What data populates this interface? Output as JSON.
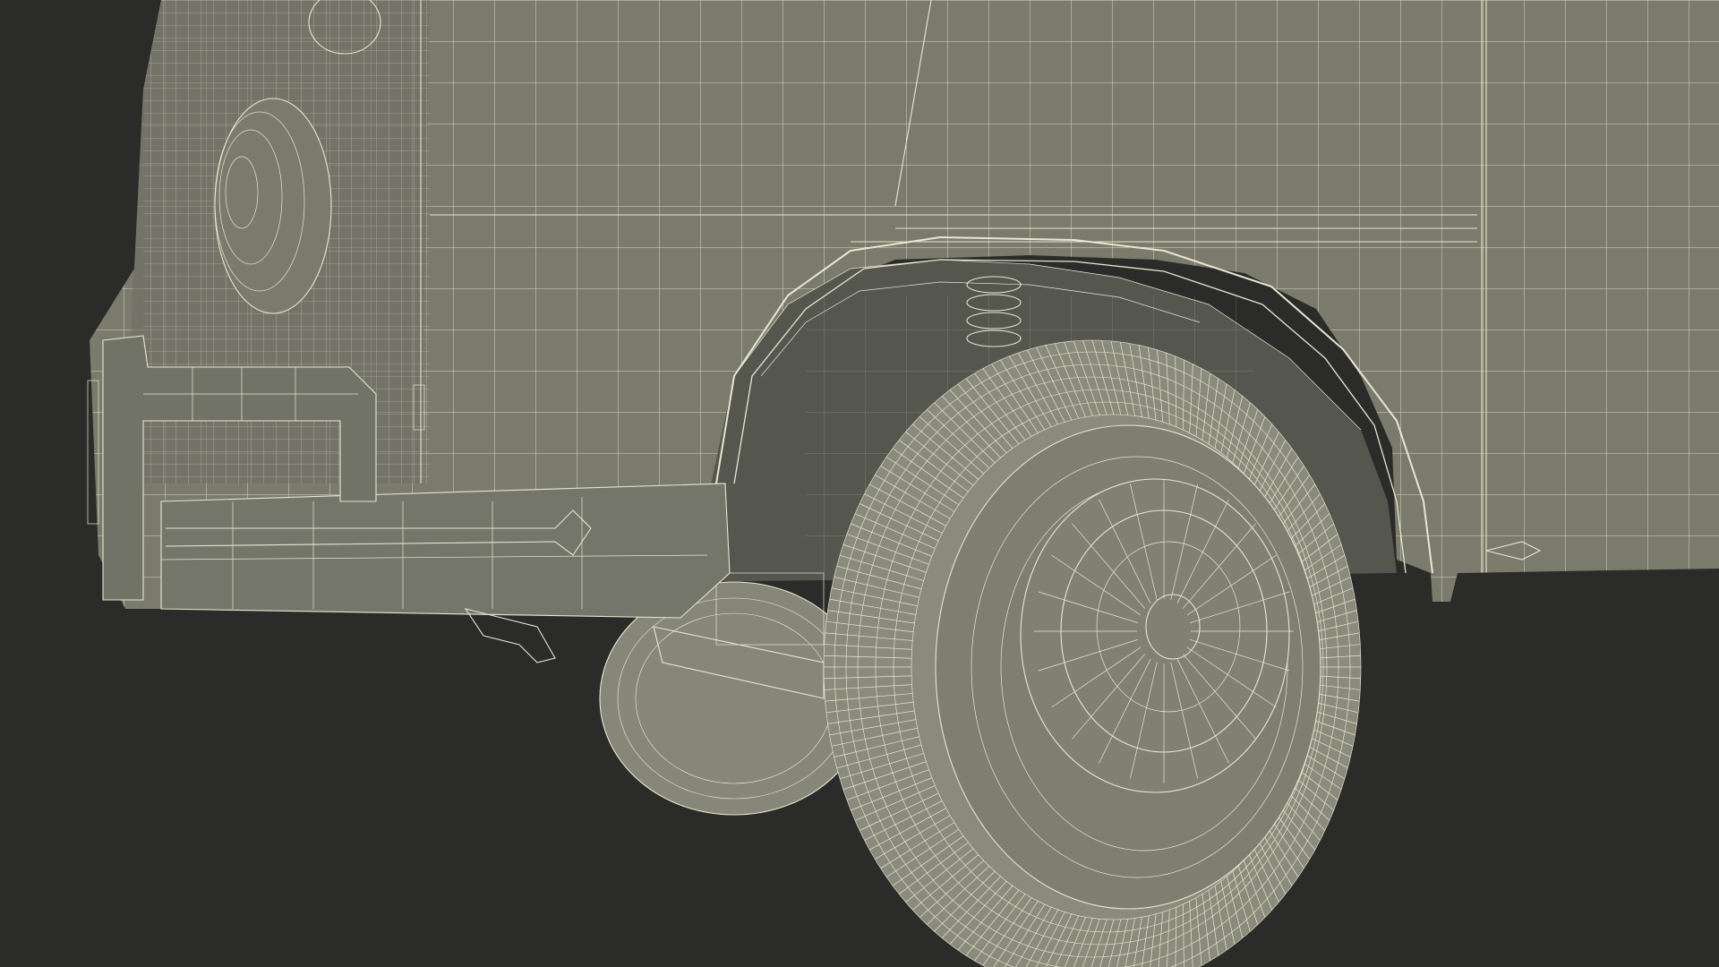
{
  "scene": {
    "subject": "wireframe-van-front-wheel",
    "colors": {
      "background": "#2b2b29",
      "body": "#7a7b6c",
      "body_shadow": "#62645a",
      "wheel_well": "#5a5c52",
      "tire": "#8a8b7c",
      "wire": "#e8e6d2"
    },
    "icons": [
      "van-body-mesh",
      "front-wheel-mesh",
      "rear-inner-wheel-mesh",
      "bumper-mesh",
      "headlight-mesh",
      "coil-spring-mesh",
      "tow-hook-mesh"
    ]
  }
}
